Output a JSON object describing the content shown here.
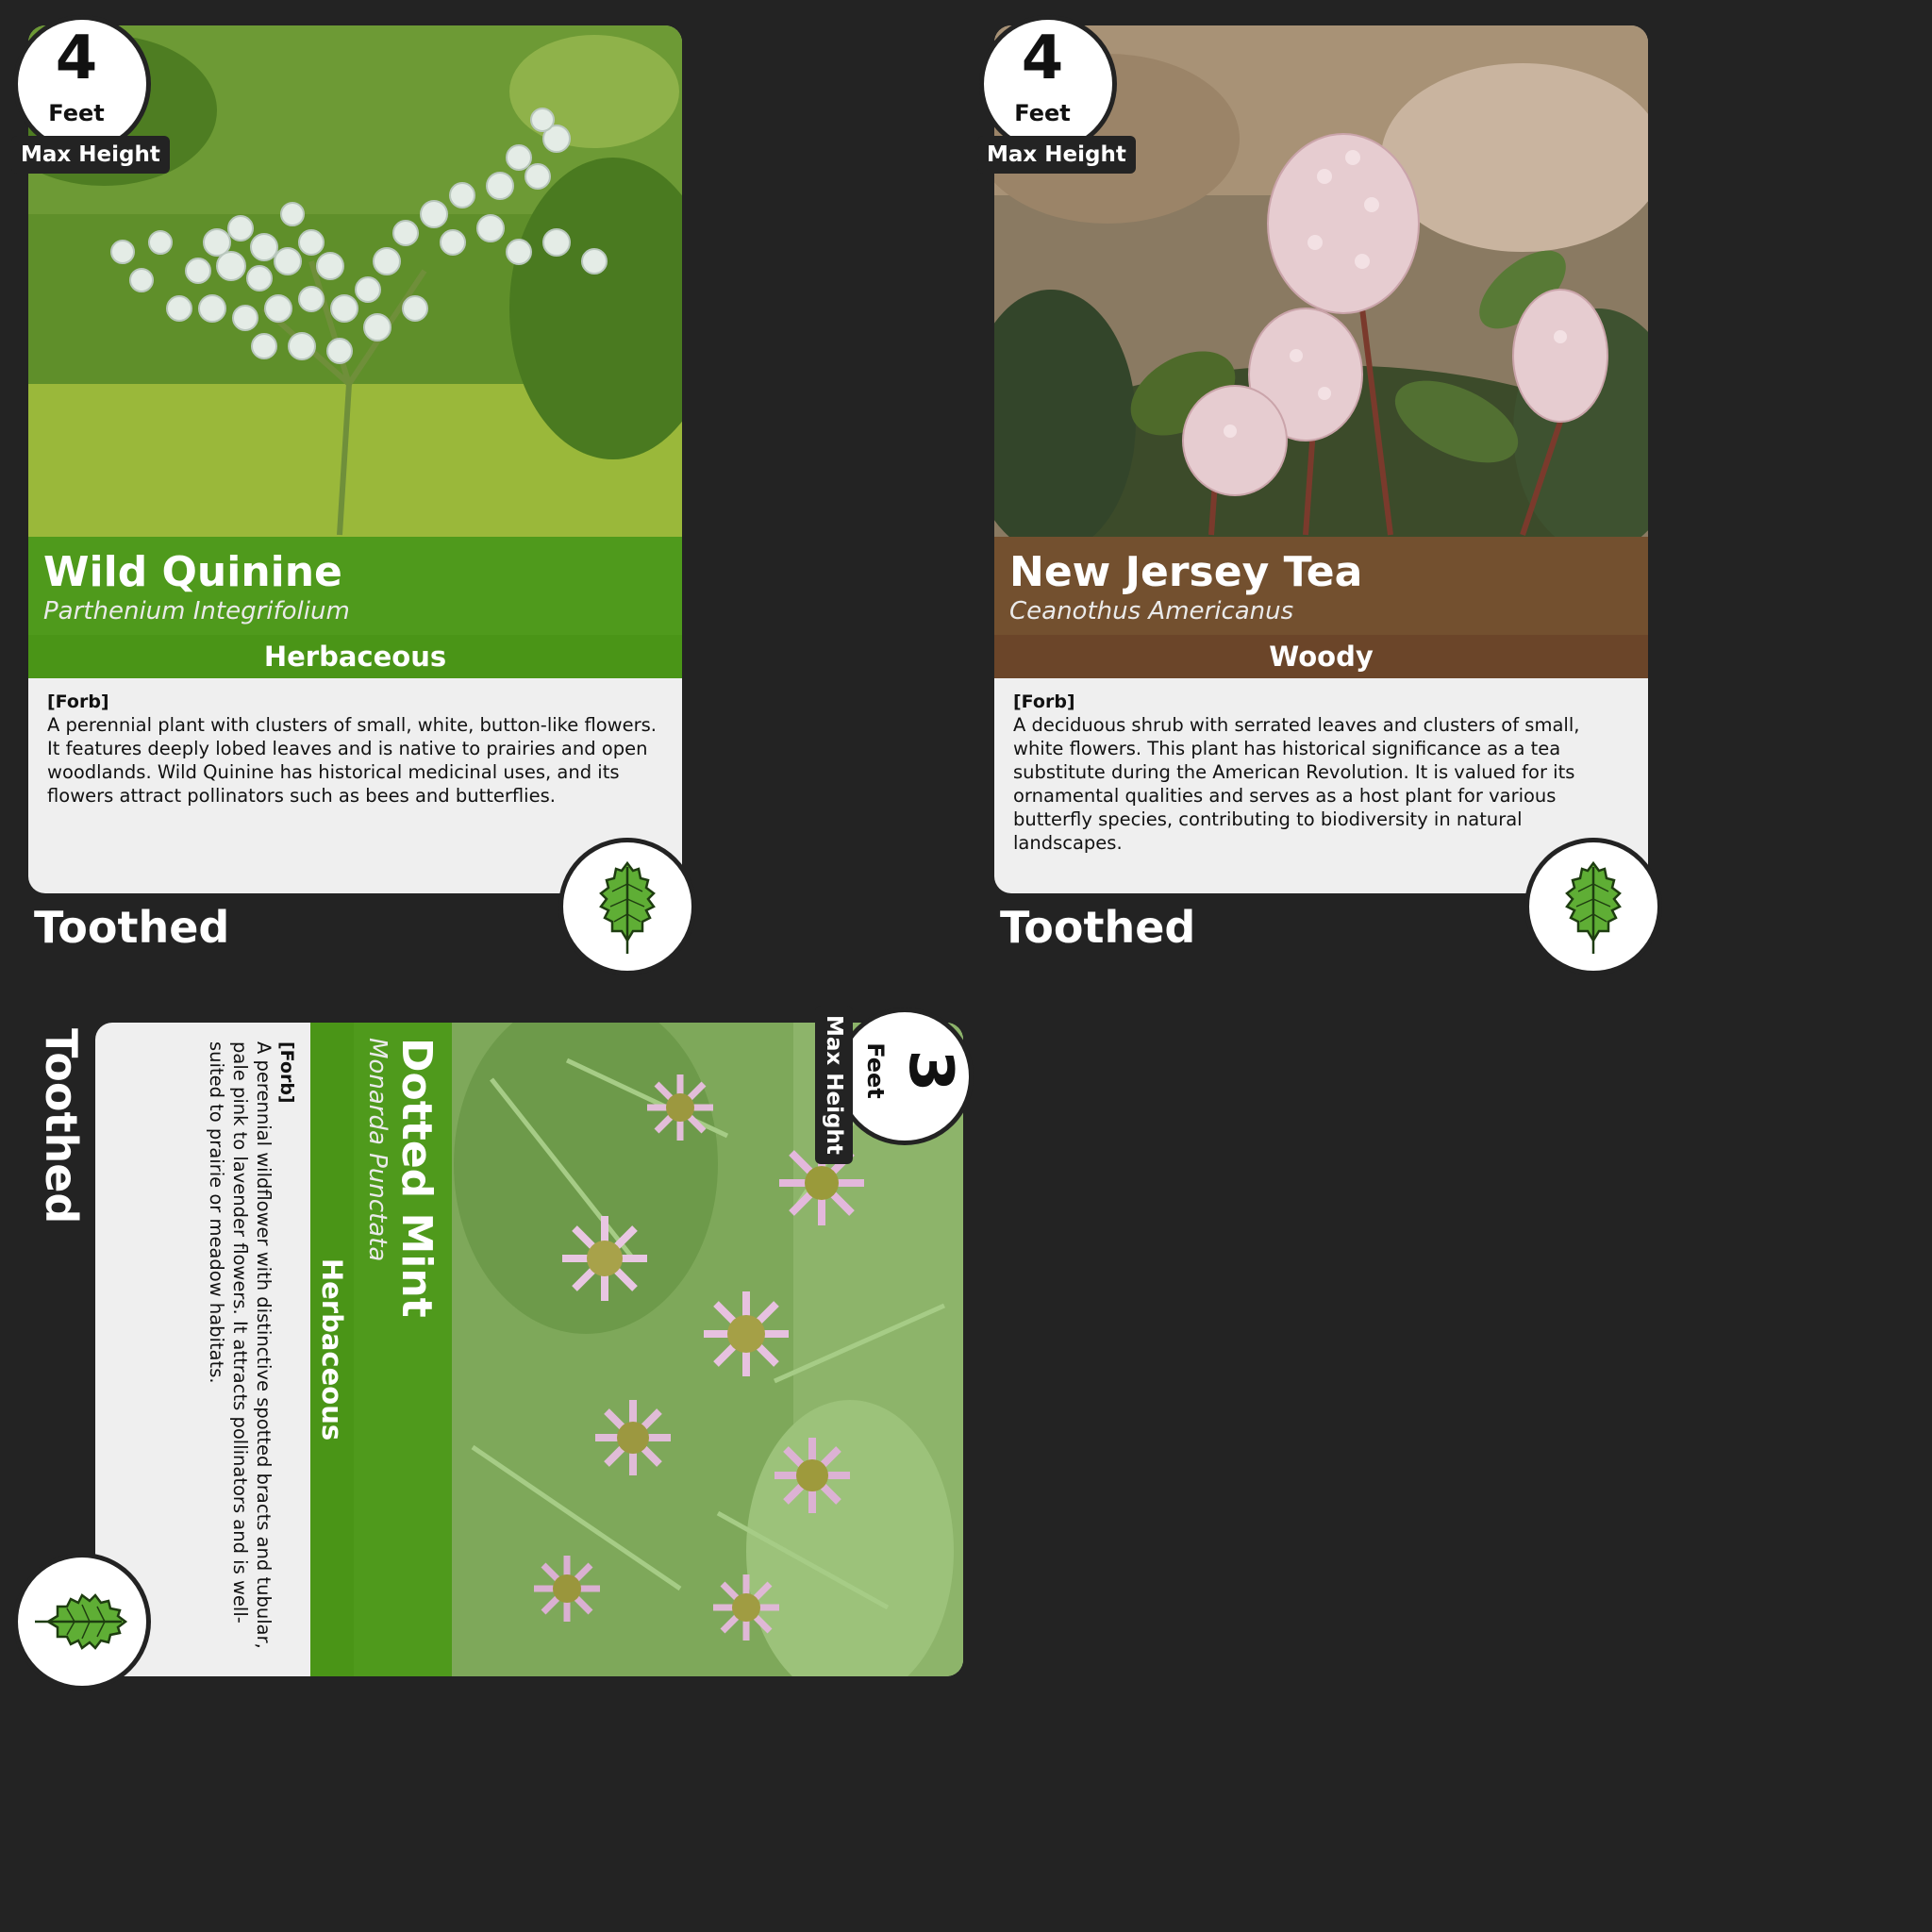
{
  "colors": {
    "background": "#232323",
    "herbaceous_green": "#4f9a1c",
    "woody_brown": "#6b4529"
  },
  "cards": [
    {
      "name": "Wild Quinine",
      "latin": "Parthenium Integrifolium",
      "type": "Herbaceous",
      "tag": "[Forb]",
      "description": "A perennial plant with clusters of small, white, button-like flowers. It features deeply lobed leaves and is native to prairies and open woodlands. Wild Quinine has historical medicinal uses, and its flowers attract pollinators such as bees and butterflies.",
      "height_value": "4",
      "height_unit": "Feet",
      "height_label": "Max Height",
      "leaf_shape": "Toothed",
      "leaf_icon": "toothed-leaf-icon"
    },
    {
      "name": "New Jersey Tea",
      "latin": "Ceanothus Americanus",
      "type": "Woody",
      "tag": "[Forb]",
      "description": "A deciduous shrub with serrated leaves and clusters of small, white flowers. This plant has historical significance as a tea substitute during the American Revolution. It is valued for its ornamental qualities and serves as a host plant for various butterfly species, contributing to biodiversity in natural landscapes.",
      "height_value": "4",
      "height_unit": "Feet",
      "height_label": "Max Height",
      "leaf_shape": "Toothed",
      "leaf_icon": "toothed-leaf-icon"
    },
    {
      "name": "Dotted Mint",
      "latin": "Monarda Punctata",
      "type": "Herbaceous",
      "tag": "[Forb]",
      "description": "A perennial wildflower with distinctive spotted bracts and tubular, pale pink to lavender flowers. It attracts pollinators and is well-suited to prairie or meadow habitats.",
      "height_value": "3",
      "height_unit": "Feet",
      "height_label": "Max Height",
      "leaf_shape": "Toothed",
      "leaf_icon": "toothed-leaf-icon",
      "orientation": "rotated-90"
    }
  ]
}
